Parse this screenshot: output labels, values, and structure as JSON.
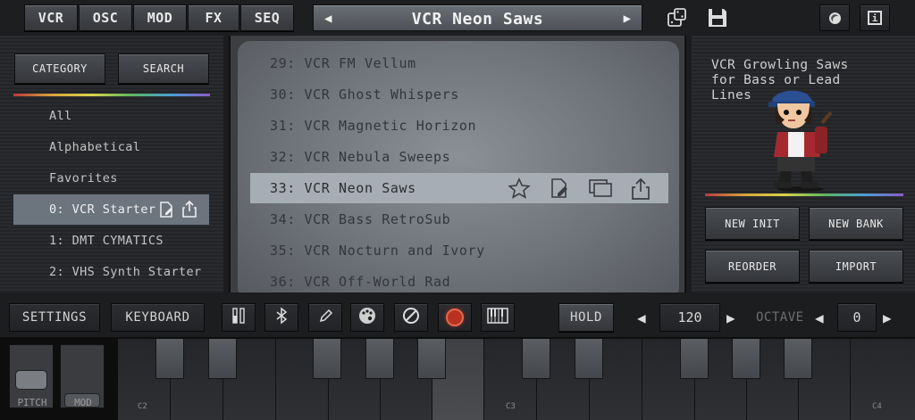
{
  "nav": {
    "tabs": [
      "VCR",
      "OSC",
      "MOD",
      "FX",
      "SEQ"
    ],
    "preset_name": "VCR Neon Saws"
  },
  "left": {
    "category_button": "CATEGORY",
    "search_button": "SEARCH",
    "categories": [
      "All",
      "Alphabetical",
      "Favorites",
      "0: VCR Starter",
      "1: DMT CYMATICS",
      "2: VHS Synth Starter"
    ],
    "selected_category": "0: VCR Starter"
  },
  "list": {
    "presets": [
      "29: VCR FM Vellum",
      "30: VCR Ghost Whispers",
      "31: VCR Magnetic Horizon",
      "32: VCR Nebula Sweeps",
      "33: VCR Neon Saws",
      "34: VCR Bass RetroSub",
      "35: VCR Nocturn and Ivory",
      "36: VCR Off-World Rad"
    ],
    "selected": "33: VCR Neon Saws"
  },
  "right": {
    "description": "VCR Growling Saws for Bass or Lead Lines",
    "buttons": [
      "NEW INIT",
      "NEW BANK",
      "REORDER",
      "IMPORT"
    ]
  },
  "toolbar": {
    "settings": "SETTINGS",
    "keyboard": "KEYBOARD",
    "hold": "HOLD",
    "tempo": "120",
    "octave_label": "OCTAVE",
    "octave": "0"
  },
  "keys": {
    "labels": [
      "C2",
      "C3",
      "C4"
    ],
    "pitch": "PITCH",
    "mod": "MOD"
  },
  "colors": {
    "record": "#b8321f",
    "selected_row": "#a7adb5",
    "selected_category": "#6c747e"
  }
}
